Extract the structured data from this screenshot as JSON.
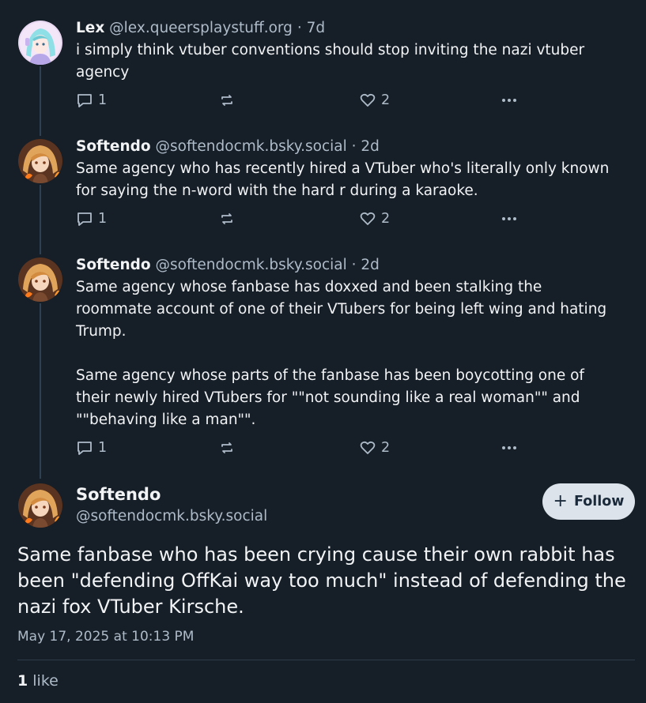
{
  "thread": [
    {
      "name": "Lex",
      "handle": "@lex.queersplaystuff.org",
      "separator": "·",
      "time": "7d",
      "text": "i simply think vtuber conventions should stop inviting the nazi vtuber agency",
      "replies": "1",
      "likes": "2",
      "avatar_icon": "lex-avatar"
    },
    {
      "name": "Softendo",
      "handle": "@softendocmk.bsky.social",
      "separator": "·",
      "time": "2d",
      "text": "Same agency who has recently hired a VTuber who's literally only known for saying the n-word with the hard r during a karaoke.",
      "replies": "1",
      "likes": "2",
      "avatar_icon": "softendo-avatar"
    },
    {
      "name": "Softendo",
      "handle": "@softendocmk.bsky.social",
      "separator": "·",
      "time": "2d",
      "text": "Same agency whose fanbase has doxxed and been stalking the roommate account of one of their VTubers for being left wing and hating Trump.\n\nSame agency whose parts of the fanbase has been boycotting one of their newly hired VTubers for \"\"not sounding like a real woman\"\" and \"\"behaving like a man\"\".",
      "replies": "1",
      "likes": "2",
      "avatar_icon": "softendo-avatar"
    }
  ],
  "main_post": {
    "name": "Softendo",
    "handle": "@softendocmk.bsky.social",
    "follow_label": "Follow",
    "text": "Same fanbase who has been crying cause their own rabbit has been \"defending OffKai way too much\" instead of defending the nazi fox VTuber Kirsche.",
    "date": "May 17, 2025 at 10:13 PM",
    "like_count": "1",
    "like_label": "like"
  },
  "colors": {
    "background": "#161e27",
    "text": "#f1f3f5",
    "muted": "#aebbc9",
    "thread_line": "#2e4052",
    "follow_bg": "#dce3ea"
  }
}
